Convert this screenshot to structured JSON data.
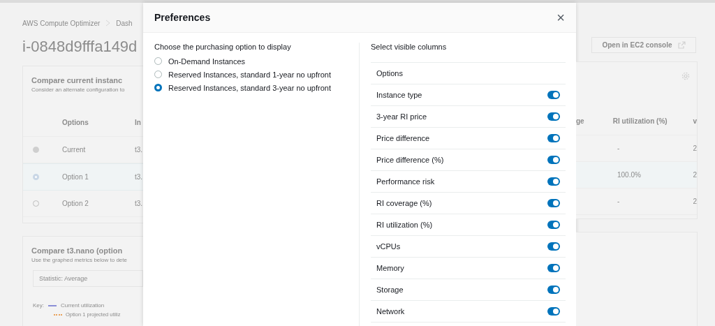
{
  "background": {
    "breadcrumb": [
      "AWS Compute Optimizer",
      "Dash"
    ],
    "page_title": "i-0848d9fffa149d",
    "open_button": "Open in EC2 console",
    "compare_card": {
      "title": "Compare current instanc",
      "subtitle": "Consider an alternate configuration to",
      "left_columns": [
        "Options",
        "In"
      ],
      "right_columns": [
        "ge",
        "RI utilization (%)",
        "v"
      ],
      "rows": [
        {
          "option": "Current",
          "cell": "t3.",
          "ri_utilization": "-",
          "vcpu": "2",
          "selected": false,
          "disabled": true
        },
        {
          "option": "Option 1",
          "cell": "t3.",
          "ri_utilization": "100.0%",
          "vcpu": "2",
          "selected": true,
          "disabled": false
        },
        {
          "option": "Option 2",
          "cell": "t3.",
          "ri_utilization": "-",
          "vcpu": "2",
          "selected": false,
          "disabled": false
        }
      ]
    },
    "metrics_card": {
      "title": "Compare t3.nano (option",
      "subtitle": "Use the graphed metrics below to dete",
      "statistic": "Statistic: Average",
      "key_label": "Key:",
      "legend": [
        {
          "label": "Current utilization",
          "kind": "solid",
          "color": "#8b8fd6"
        },
        {
          "label": "Option 1 projected utiliz",
          "kind": "dotted",
          "color": "#e8a25a"
        }
      ]
    }
  },
  "modal": {
    "title": "Preferences",
    "close": "×",
    "purchasing": {
      "label": "Choose the purchasing option to display",
      "options": [
        {
          "label": "On-Demand Instances",
          "selected": false
        },
        {
          "label": "Reserved Instances, standard 1-year no upfront",
          "selected": false
        },
        {
          "label": "Reserved Instances, standard 3-year no upfront",
          "selected": true
        }
      ]
    },
    "columns": {
      "label": "Select visible columns",
      "items": [
        {
          "label": "Options",
          "kind": "fixed"
        },
        {
          "label": "Instance type",
          "kind": "toggle",
          "on": true
        },
        {
          "label": "3-year RI price",
          "kind": "toggle",
          "on": true
        },
        {
          "label": "Price difference",
          "kind": "toggle",
          "on": true
        },
        {
          "label": "Price difference (%)",
          "kind": "toggle",
          "on": true
        },
        {
          "label": "Performance risk",
          "kind": "toggle",
          "on": true
        },
        {
          "label": "RI coverage (%)",
          "kind": "toggle",
          "on": true
        },
        {
          "label": "RI utilization (%)",
          "kind": "toggle",
          "on": true
        },
        {
          "label": "vCPUs",
          "kind": "toggle",
          "on": true
        },
        {
          "label": "Memory",
          "kind": "toggle",
          "on": true
        },
        {
          "label": "Storage",
          "kind": "toggle",
          "on": true
        },
        {
          "label": "Network",
          "kind": "toggle",
          "on": true
        }
      ]
    }
  }
}
